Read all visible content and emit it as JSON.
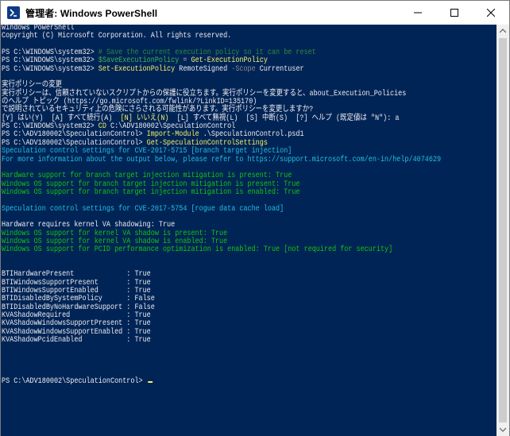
{
  "window": {
    "title": "管理者: Windows PowerShell",
    "icon": "powershell-icon",
    "controls": [
      "minimize-icon",
      "maximize-icon",
      "close-icon"
    ]
  },
  "colors": {
    "console_bg": "#012456",
    "default_text": "#eeedf0",
    "comment": "#2e8b3b",
    "variable": "#3fb54b",
    "command": "#f5f169",
    "parameter": "#8a8a8a",
    "info_cyan": "#21c0e0",
    "info_green": "#16c60c"
  },
  "console": {
    "lines": [
      [
        {
          "t": "Windows PowerShell",
          "c": "default"
        }
      ],
      [
        {
          "t": "Copyright (C) Microsoft Corporation. All rights reserved.",
          "c": "default"
        }
      ],
      [
        {
          "t": "",
          "c": "default"
        }
      ],
      [
        {
          "t": "PS C:\\WINDOWS\\system32> ",
          "c": "default"
        },
        {
          "t": "# Save the current execution policy so it can be reset",
          "c": "comment"
        }
      ],
      [
        {
          "t": "PS C:\\WINDOWS\\system32> ",
          "c": "default"
        },
        {
          "t": "$SaveExecutionPolicy",
          "c": "var"
        },
        {
          "t": " = ",
          "c": "op"
        },
        {
          "t": "Get-ExecutionPolicy",
          "c": "cmd"
        }
      ],
      [
        {
          "t": "PS C:\\WINDOWS\\system32> ",
          "c": "default"
        },
        {
          "t": "Set-ExecutionPolicy",
          "c": "cmd"
        },
        {
          "t": " RemoteSigned ",
          "c": "default"
        },
        {
          "t": "-Scope",
          "c": "param"
        },
        {
          "t": " Currentuser",
          "c": "default"
        }
      ],
      [
        {
          "t": "",
          "c": "default"
        }
      ],
      [
        {
          "t": "実行ポリシーの変更",
          "c": "default"
        }
      ],
      [
        {
          "t": "実行ポリシーは、信頼されていないスクリプトからの保護に役立ちます。実行ポリシーを変更すると、about_Execution_Policies",
          "c": "default"
        }
      ],
      [
        {
          "t": "のヘルプ トピック (https://go.microsoft.com/fwlink/?LinkID=135170)",
          "c": "default"
        }
      ],
      [
        {
          "t": "で説明されているセキュリティ上の危険にさらされる可能性があります。実行ポリシーを変更しますか?",
          "c": "default"
        }
      ],
      [
        {
          "t": "[Y] はい(Y)  [A] すべて続行(A)  ",
          "c": "default"
        },
        {
          "t": "[N] いいえ(N)",
          "c": "cmd"
        },
        {
          "t": "  [L] すべて無視(L)  [S] 中断(S)  [?] ヘルプ (既定値は \"N\"): a",
          "c": "default"
        }
      ],
      [
        {
          "t": "PS C:\\WINDOWS\\system32> ",
          "c": "default"
        },
        {
          "t": "CD",
          "c": "cmd"
        },
        {
          "t": " C:\\ADV180002\\SpeculationControl",
          "c": "default"
        }
      ],
      [
        {
          "t": "PS C:\\ADV180002\\SpeculationControl> ",
          "c": "default"
        },
        {
          "t": "Import-Module",
          "c": "cmd"
        },
        {
          "t": " .\\SpeculationControl.psd1",
          "c": "default"
        }
      ],
      [
        {
          "t": "PS C:\\ADV180002\\SpeculationControl> ",
          "c": "default"
        },
        {
          "t": "Get-SpeculationControlSettings",
          "c": "cmd"
        }
      ],
      [
        {
          "t": "Speculation control settings for CVE-2017-5715 [branch target injection]",
          "c": "cyan"
        }
      ],
      [
        {
          "t": "For more information about the output below, please refer to https://support.microsoft.com/en-in/help/4074629",
          "c": "cyan"
        }
      ],
      [
        {
          "t": "",
          "c": "default"
        }
      ],
      [
        {
          "t": "Hardware support for branch target injection mitigation is present: True",
          "c": "green"
        }
      ],
      [
        {
          "t": "Windows OS support for branch target injection mitigation is present: True",
          "c": "green"
        }
      ],
      [
        {
          "t": "Windows OS support for branch target injection mitigation is enabled: True",
          "c": "green"
        }
      ],
      [
        {
          "t": "",
          "c": "default"
        }
      ],
      [
        {
          "t": "Speculation control settings for CVE-2017-5754 [rogue data cache load]",
          "c": "cyan"
        }
      ],
      [
        {
          "t": "",
          "c": "default"
        }
      ],
      [
        {
          "t": "Hardware requires kernel VA shadowing: True",
          "c": "default"
        }
      ],
      [
        {
          "t": "Windows OS support for kernel VA shadow is present: True",
          "c": "green"
        }
      ],
      [
        {
          "t": "Windows OS support for kernel VA shadow is enabled: True",
          "c": "green"
        }
      ],
      [
        {
          "t": "Windows OS support for PCID performance optimization is enabled: True [not required for security]",
          "c": "green"
        }
      ],
      [
        {
          "t": "",
          "c": "default"
        }
      ],
      [
        {
          "t": "",
          "c": "default"
        }
      ],
      [
        {
          "t": "BTIHardwarePresent             : True",
          "c": "default"
        }
      ],
      [
        {
          "t": "BTIWindowsSupportPresent       : True",
          "c": "default"
        }
      ],
      [
        {
          "t": "BTIWindowsSupportEnabled       : True",
          "c": "default"
        }
      ],
      [
        {
          "t": "BTIDisabledBySystemPolicy      : False",
          "c": "default"
        }
      ],
      [
        {
          "t": "BTIDisabledByNoHardwareSupport : False",
          "c": "default"
        }
      ],
      [
        {
          "t": "KVAShadowRequired              : True",
          "c": "default"
        }
      ],
      [
        {
          "t": "KVAShadowWindowsSupportPresent : True",
          "c": "default"
        }
      ],
      [
        {
          "t": "KVAShadowWindowsSupportEnabled : True",
          "c": "default"
        }
      ],
      [
        {
          "t": "KVAShadowPcidEnabled           : True",
          "c": "default"
        }
      ],
      [
        {
          "t": "",
          "c": "default"
        }
      ],
      [
        {
          "t": "",
          "c": "default"
        }
      ],
      [
        {
          "t": "",
          "c": "default"
        }
      ],
      [
        {
          "t": "",
          "c": "default"
        }
      ],
      [
        {
          "t": "PS C:\\ADV180002\\SpeculationControl> ",
          "c": "default",
          "cursor": true
        }
      ]
    ]
  }
}
